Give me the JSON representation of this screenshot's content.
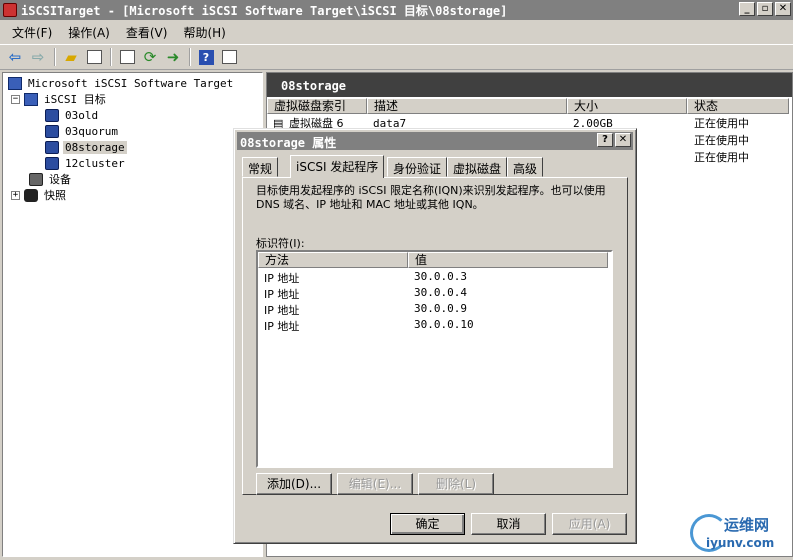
{
  "window": {
    "title": "iSCSITarget - [Microsoft iSCSI Software Target\\iSCSI 目标\\08storage]",
    "minimize": "_",
    "restore": "▫",
    "close": "✕"
  },
  "menu": [
    "文件(F)",
    "操作(A)",
    "查看(V)",
    "帮助(H)"
  ],
  "toolbar": {
    "icons": [
      "back-arrow-icon",
      "forward-arrow-icon",
      "up-folder-icon",
      "show-hide-tree-icon",
      "properties-icon",
      "refresh-icon",
      "export-list-icon",
      "help-icon",
      "console-icon"
    ],
    "help_glyph": "?"
  },
  "tree": {
    "root": "Microsoft iSCSI Software Target",
    "targets_label": "iSCSI 目标",
    "targets": [
      "03old",
      "03quorum",
      "08storage",
      "12cluster"
    ],
    "selected": "08storage",
    "devices": "设备",
    "snapshots": "快照",
    "expand_minus": "−",
    "expand_plus": "+"
  },
  "pane": {
    "header": "08storage",
    "columns": [
      "虚拟磁盘索引",
      "描述",
      "大小",
      "状态"
    ],
    "rows": [
      {
        "index": "虚拟磁盘 6",
        "desc": "data7",
        "size": "2.00GB",
        "status": "正在使用中"
      },
      {
        "index": "",
        "desc": "",
        "size": "",
        "status": "正在使用中"
      },
      {
        "index": "",
        "desc": "",
        "size": "",
        "status": "正在使用中"
      }
    ]
  },
  "dialog": {
    "title": "08storage 属性",
    "help": "?",
    "close": "✕",
    "tabs": [
      "常规",
      "iSCSI 发起程序",
      "身份验证",
      "虚拟磁盘",
      "高级"
    ],
    "active_tab": "iSCSI 发起程序",
    "description": "目标使用发起程序的 iSCSI 限定名称(IQN)来识别发起程序。也可以使用 DNS 域名、IP 地址和 MAC 地址或其他 IQN。",
    "identifier_label": "标识符(I):",
    "list_columns": [
      "方法",
      "值"
    ],
    "identifiers": [
      {
        "method": "IP 地址",
        "value": "30.0.0.3"
      },
      {
        "method": "IP 地址",
        "value": "30.0.0.4"
      },
      {
        "method": "IP 地址",
        "value": "30.0.0.9"
      },
      {
        "method": "IP 地址",
        "value": "30.0.0.10"
      }
    ],
    "add_button": "添加(D)...",
    "edit_button": "编辑(E)...",
    "delete_button": "删除(L)",
    "ok_button": "确定",
    "cancel_button": "取消",
    "apply_button": "应用(A)"
  },
  "watermark": {
    "cn": "运维网",
    "url": "iyunv.com"
  }
}
